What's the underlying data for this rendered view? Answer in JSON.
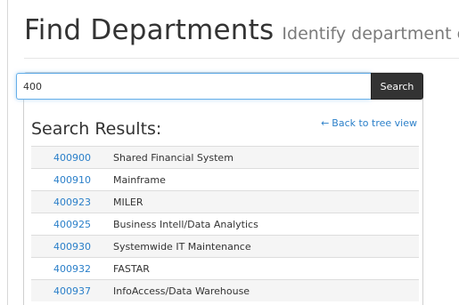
{
  "header": {
    "title": "Find Departments",
    "subtitle": "Identify department entities"
  },
  "search": {
    "value": "400",
    "button_label": "Search"
  },
  "results": {
    "title": "Search Results:",
    "back_link": "Back to tree view",
    "rows": [
      {
        "code": "400900",
        "name": "Shared Financial System"
      },
      {
        "code": "400910",
        "name": "Mainframe"
      },
      {
        "code": "400923",
        "name": "MILER"
      },
      {
        "code": "400925",
        "name": "Business Intell/Data Analytics"
      },
      {
        "code": "400930",
        "name": "Systemwide IT Maintenance"
      },
      {
        "code": "400932",
        "name": "FASTAR"
      },
      {
        "code": "400937",
        "name": "InfoAccess/Data Warehouse"
      }
    ]
  },
  "colors": {
    "link": "#2a7fc9",
    "button_bg": "#333333",
    "focus_border": "#66afe9"
  },
  "icons": {
    "back": "arrow-left-icon"
  }
}
